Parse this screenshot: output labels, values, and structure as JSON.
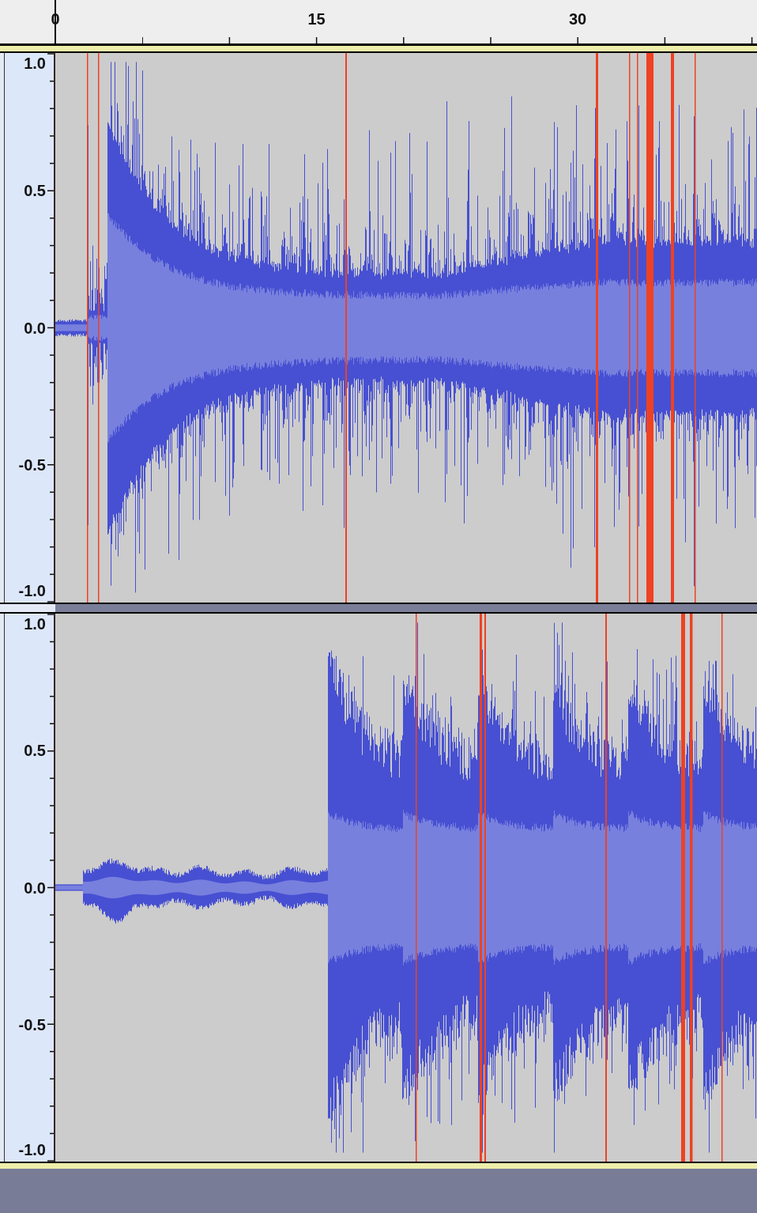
{
  "time_ruler": {
    "labels": [
      "0",
      "15",
      "30"
    ]
  },
  "tracks": [
    {
      "amplitude_labels": [
        "1.0",
        "0.5",
        "0.0",
        "-0.5",
        "-1.0"
      ]
    },
    {
      "amplitude_labels": [
        "1.0",
        "0.5",
        "0.0",
        "-0.5",
        "-1.0"
      ]
    }
  ]
}
